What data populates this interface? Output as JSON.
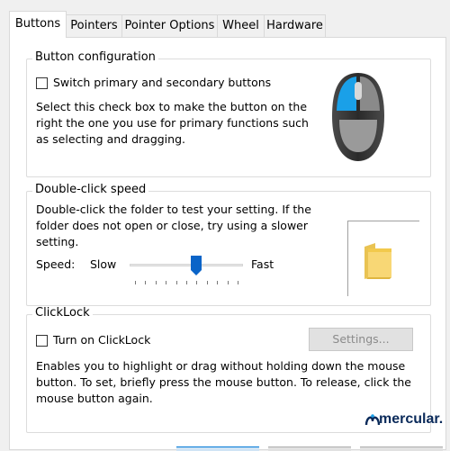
{
  "tabs": [
    {
      "label": "Buttons",
      "active": true
    },
    {
      "label": "Pointers",
      "active": false
    },
    {
      "label": "Pointer Options",
      "active": false
    },
    {
      "label": "Wheel",
      "active": false
    },
    {
      "label": "Hardware",
      "active": false
    }
  ],
  "button_config": {
    "legend": "Button configuration",
    "checkbox_label": "Switch primary and secondary buttons",
    "checked": false,
    "description": [
      "Select this check box to make the button on the",
      "right the one you use for primary functions such",
      "as selecting and dragging."
    ],
    "mouse_icon": "mouse-icon"
  },
  "double_click": {
    "legend": "Double-click speed",
    "description": [
      "Double-click the folder to test your setting. If the",
      "folder does not open or close, try using a slower",
      "setting."
    ],
    "speed_label": "Speed:",
    "slow_label": "Slow",
    "fast_label": "Fast",
    "slider_value_fraction": 0.6,
    "tick_count": 11,
    "folder_icon": "folder-icon"
  },
  "clicklock": {
    "legend": "ClickLock",
    "checkbox_label": "Turn on ClickLock",
    "checked": false,
    "settings_label": "Settings...",
    "description": [
      "Enables you to highlight or drag without holding down the mouse",
      "button. To set, briefly press the mouse button. To release, click the",
      "mouse button again."
    ]
  },
  "watermark": "mercular."
}
